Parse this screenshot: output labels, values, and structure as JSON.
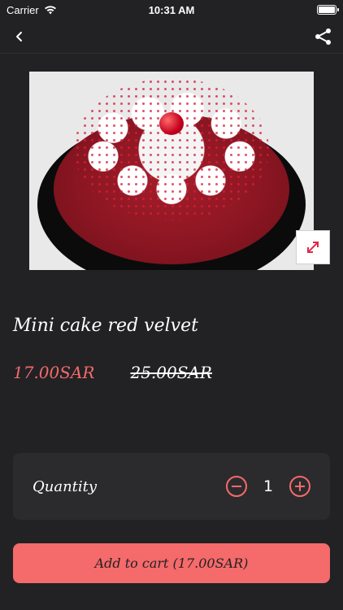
{
  "status_bar": {
    "carrier": "Carrier",
    "time": "10:31 AM"
  },
  "product": {
    "title": "Mini cake red velvet",
    "price_current": "17.00SAR",
    "price_old": "25.00SAR"
  },
  "quantity": {
    "label": "Quantity",
    "value": "1"
  },
  "actions": {
    "add_to_cart_label": "Add to cart (17.00SAR)"
  },
  "colors": {
    "accent": "#f56a6a",
    "background": "#222225",
    "card": "#2b2b2e"
  },
  "icons": {
    "back": "chevron-left-icon",
    "share": "share-icon",
    "expand": "expand-arrows-icon",
    "decrement": "minus-circle-icon",
    "increment": "plus-circle-icon"
  }
}
